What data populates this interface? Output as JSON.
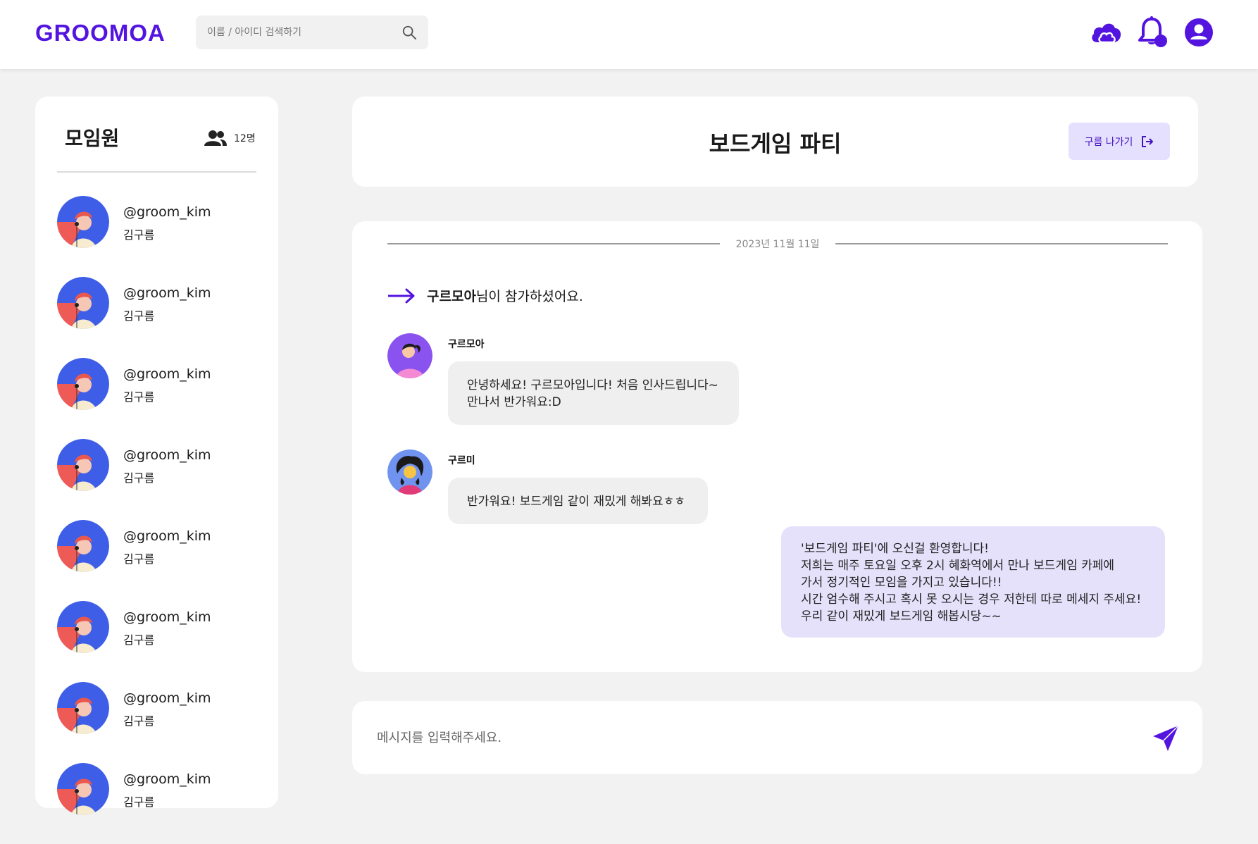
{
  "brand": {
    "logo_text": "GROOMOA",
    "accent_color": "#5314e0"
  },
  "header": {
    "search": {
      "placeholder": "이름 / 아이디 검색하기",
      "value": ""
    },
    "icons": [
      "cloud-icon",
      "bell-icon",
      "profile-icon"
    ]
  },
  "sidebar": {
    "title": "모임원",
    "member_count": "12명",
    "members": [
      {
        "handle": "@groom_kim",
        "name": "김구름"
      },
      {
        "handle": "@groom_kim",
        "name": "김구름"
      },
      {
        "handle": "@groom_kim",
        "name": "김구름"
      },
      {
        "handle": "@groom_kim",
        "name": "김구름"
      },
      {
        "handle": "@groom_kim",
        "name": "김구름"
      },
      {
        "handle": "@groom_kim",
        "name": "김구름"
      },
      {
        "handle": "@groom_kim",
        "name": "김구름"
      },
      {
        "handle": "@groom_kim",
        "name": "김구름"
      }
    ]
  },
  "room": {
    "title": "보드게임 파티",
    "leave_label": "구름 나가기"
  },
  "chat": {
    "date": "2023년 11월 11일",
    "join_notice": {
      "user": "구르모아",
      "text": "님이 참가하셨어요."
    },
    "messages": [
      {
        "sender": "구르모아",
        "text": "안녕하세요! 구르모아입니다! 처음 인사드립니다~\n만나서 반가워요:D"
      },
      {
        "sender": "구르미",
        "text": "반가워요!  보드게임 같이 재밌게 해봐요ㅎㅎ"
      },
      {
        "sender": "",
        "text": "'보드게임 파티'에 오신걸 환영합니다!\n저희는 매주 토요일 오후 2시 혜화역에서 만나 보드게임 카페에\n가서 정기적인 모임을 가지고 있습니다!!\n시간 엄수해 주시고 혹시 못 오시는 경우 저한테 따로 메세지 주세요!\n우리 같이 재밌게 보드게임 해봅시당~~"
      }
    ]
  },
  "composer": {
    "placeholder": "메시지를 입력해주세요.",
    "value": ""
  }
}
